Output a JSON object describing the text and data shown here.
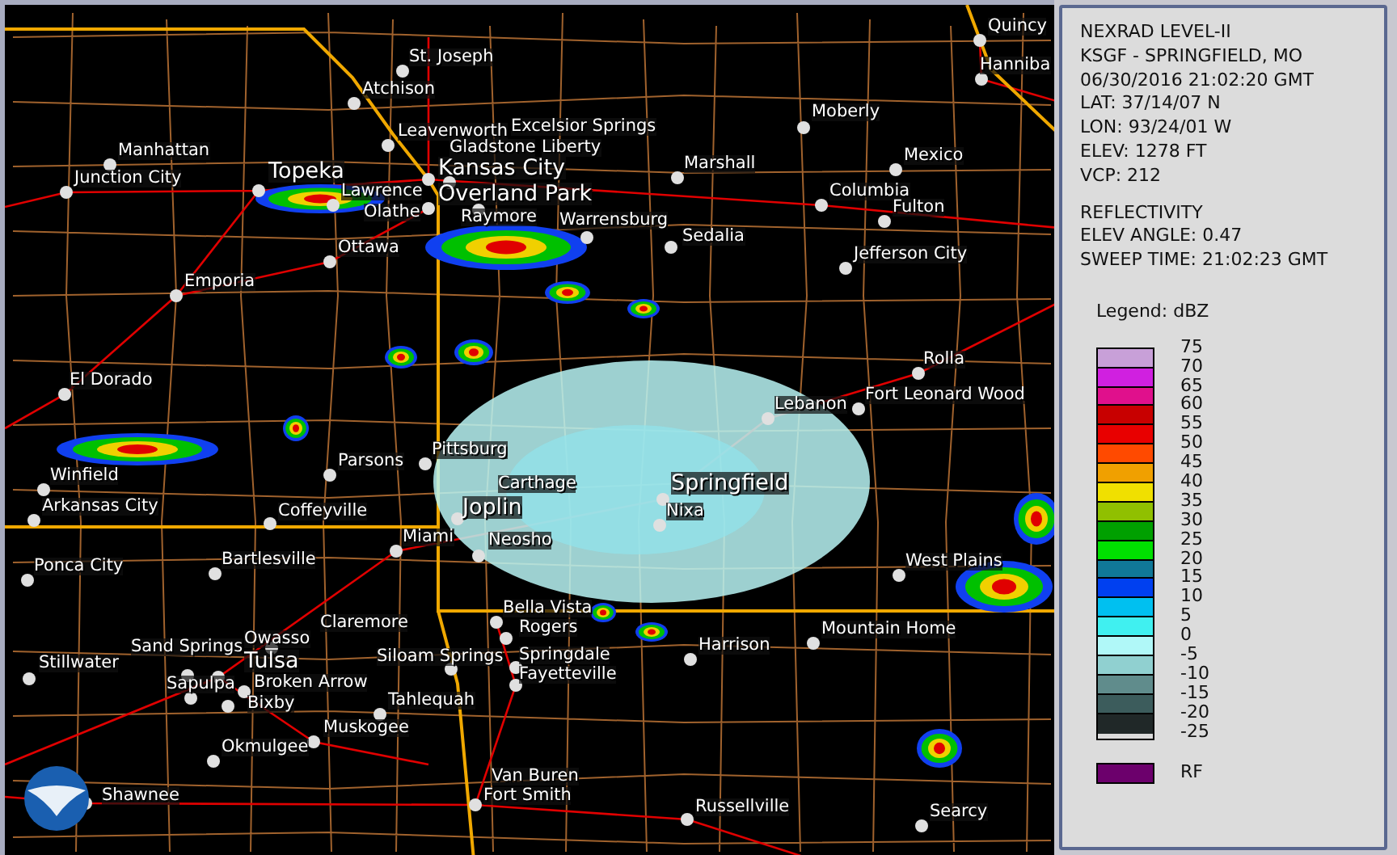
{
  "map": {
    "cities": [
      {
        "label": "St. Joseph",
        "major": false,
        "dot": true
      },
      {
        "label": "Atchison",
        "major": false,
        "dot": true
      },
      {
        "label": "Leavenworth",
        "major": false,
        "dot": true
      },
      {
        "label": "Excelsior Springs",
        "major": false,
        "dot": false
      },
      {
        "label": "Manhattan",
        "major": false,
        "dot": true
      },
      {
        "label": "Junction City",
        "major": false,
        "dot": true
      },
      {
        "label": "Topeka",
        "major": true,
        "dot": true
      },
      {
        "label": "Lawrence",
        "major": false,
        "dot": true
      },
      {
        "label": "Gladstone",
        "major": false,
        "dot": false
      },
      {
        "label": "Liberty",
        "major": false,
        "dot": false
      },
      {
        "label": "Kansas City",
        "major": true,
        "dot": true
      },
      {
        "label": "Overland Park",
        "major": true,
        "dot": true
      },
      {
        "label": "Olathe",
        "major": false,
        "dot": true
      },
      {
        "label": "Raymore",
        "major": false,
        "dot": true
      },
      {
        "label": "Ottawa",
        "major": false,
        "dot": true
      },
      {
        "label": "Emporia",
        "major": false,
        "dot": true
      },
      {
        "label": "Marshall",
        "major": false,
        "dot": true
      },
      {
        "label": "Moberly",
        "major": false,
        "dot": true
      },
      {
        "label": "Mexico",
        "major": false,
        "dot": true
      },
      {
        "label": "Columbia",
        "major": false,
        "dot": true
      },
      {
        "label": "Fulton",
        "major": false,
        "dot": true
      },
      {
        "label": "Warrensburg",
        "major": false,
        "dot": true
      },
      {
        "label": "Sedalia",
        "major": false,
        "dot": true
      },
      {
        "label": "Jefferson City",
        "major": false,
        "dot": true
      },
      {
        "label": "Quincy",
        "major": false,
        "dot": true
      },
      {
        "label": "Hanniba",
        "major": false,
        "dot": true
      },
      {
        "label": "Rolla",
        "major": false,
        "dot": true
      },
      {
        "label": "Fort Leonard Wood",
        "major": false,
        "dot": true
      },
      {
        "label": "Lebanon",
        "major": false,
        "dot": true
      },
      {
        "label": "Springfield",
        "major": true,
        "dot": true
      },
      {
        "label": "Nixa",
        "major": false,
        "dot": true
      },
      {
        "label": "Carthage",
        "major": false,
        "dot": false
      },
      {
        "label": "Joplin",
        "major": true,
        "dot": true
      },
      {
        "label": "Neosho",
        "major": false,
        "dot": true
      },
      {
        "label": "Pittsburg",
        "major": false,
        "dot": true
      },
      {
        "label": "Parsons",
        "major": false,
        "dot": true
      },
      {
        "label": "Coffeyville",
        "major": false,
        "dot": true
      },
      {
        "label": "El Dorado",
        "major": false,
        "dot": true
      },
      {
        "label": "Winfield",
        "major": false,
        "dot": true
      },
      {
        "label": "Arkansas City",
        "major": false,
        "dot": true
      },
      {
        "label": "Miami",
        "major": false,
        "dot": true
      },
      {
        "label": "Ponca City",
        "major": false,
        "dot": true
      },
      {
        "label": "Bartlesville",
        "major": false,
        "dot": true
      },
      {
        "label": "West Plains",
        "major": false,
        "dot": true
      },
      {
        "label": "Claremore",
        "major": false,
        "dot": false
      },
      {
        "label": "Owasso",
        "major": false,
        "dot": true
      },
      {
        "label": "Bella Vista",
        "major": false,
        "dot": true
      },
      {
        "label": "Rogers",
        "major": false,
        "dot": true
      },
      {
        "label": "Siloam Springs",
        "major": false,
        "dot": true
      },
      {
        "label": "Springdale",
        "major": false,
        "dot": true
      },
      {
        "label": "Fayetteville",
        "major": false,
        "dot": true
      },
      {
        "label": "Harrison",
        "major": false,
        "dot": true
      },
      {
        "label": "Mountain Home",
        "major": false,
        "dot": true
      },
      {
        "label": "Stillwater",
        "major": false,
        "dot": true
      },
      {
        "label": "Sand Springs",
        "major": false,
        "dot": true
      },
      {
        "label": "Tulsa",
        "major": true,
        "dot": true
      },
      {
        "label": "Sapulpa",
        "major": false,
        "dot": true
      },
      {
        "label": "Broken Arrow",
        "major": false,
        "dot": true
      },
      {
        "label": "Bixby",
        "major": false,
        "dot": true
      },
      {
        "label": "Tahlequah",
        "major": false,
        "dot": true
      },
      {
        "label": "Muskogee",
        "major": false,
        "dot": true
      },
      {
        "label": "Okmulgee",
        "major": false,
        "dot": true
      },
      {
        "label": "Van Buren",
        "major": false,
        "dot": false
      },
      {
        "label": "Fort Smith",
        "major": false,
        "dot": true
      },
      {
        "label": "Russellville",
        "major": false,
        "dot": true
      },
      {
        "label": "Searcy",
        "major": false,
        "dot": true
      },
      {
        "label": "Shawnee",
        "major": false,
        "dot": true
      }
    ]
  },
  "info": {
    "lines": [
      "NEXRAD LEVEL-II",
      "KSGF - SPRINGFIELD, MO",
      "06/30/2016 21:02:20 GMT",
      "LAT: 37/14/07 N",
      "LON: 93/24/01 W",
      "ELEV: 1278 FT",
      "VCP: 212"
    ],
    "product_lines": [
      "REFLECTIVITY",
      "ELEV ANGLE: 0.47",
      "SWEEP TIME: 21:02:23 GMT"
    ]
  },
  "legend": {
    "title": "Legend: dBZ",
    "swatches": [
      {
        "color": "#c8a0d8"
      },
      {
        "color": "#d020e0"
      },
      {
        "color": "#e0108c"
      },
      {
        "color": "#c80000"
      },
      {
        "color": "#e80000"
      },
      {
        "color": "#ff4a00"
      },
      {
        "color": "#f0a000"
      },
      {
        "color": "#f0e000"
      },
      {
        "color": "#90c000"
      },
      {
        "color": "#00a000"
      },
      {
        "color": "#00e000"
      },
      {
        "color": "#107898"
      },
      {
        "color": "#0040f0"
      },
      {
        "color": "#00c0f0"
      },
      {
        "color": "#40f0f0"
      },
      {
        "color": "#b0f8f8"
      },
      {
        "color": "#90d0d0"
      },
      {
        "color": "#608c8c"
      },
      {
        "color": "#3c5c5c"
      },
      {
        "color": "#202828"
      }
    ],
    "scale_labels": [
      "75",
      "70",
      "65",
      "60",
      "55",
      "50",
      "45",
      "40",
      "35",
      "30",
      "25",
      "20",
      "15",
      "10",
      "5",
      "0",
      "-5",
      "-10",
      "-15",
      "-20",
      "-25"
    ],
    "rf": {
      "label": "RF",
      "color": "#6c006c"
    }
  }
}
